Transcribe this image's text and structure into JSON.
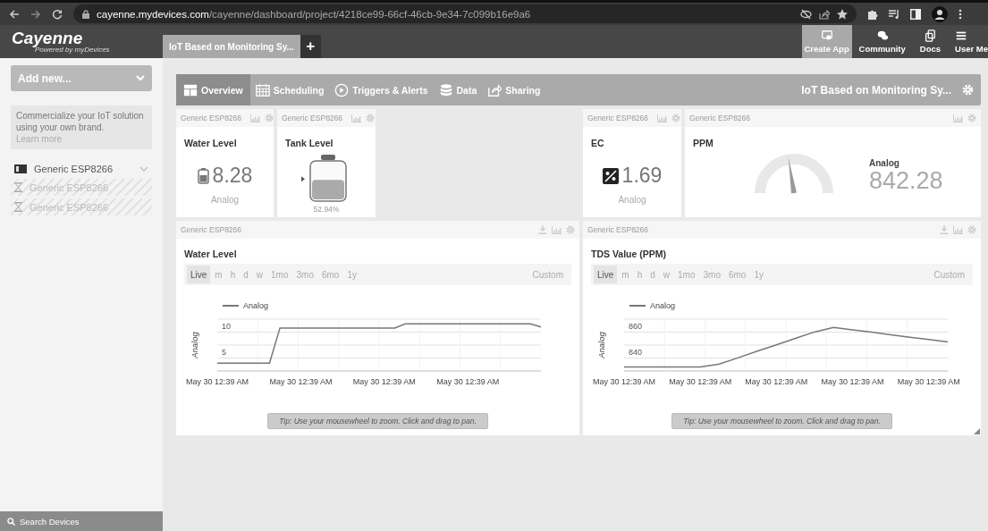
{
  "browser": {
    "url_host": "cayenne.mydevices.com",
    "url_path": "/cayenne/dashboard/project/4218ce99-66cf-46cb-9e34-7c099b16e9a6"
  },
  "app": {
    "logo": "Cayenne",
    "tagline": "Powered by myDevices"
  },
  "project_tabs": [
    {
      "label": "IoT Based on Monitoring Sy...",
      "selected": true
    }
  ],
  "add_tab": "+",
  "header_buttons": [
    {
      "label": "Create App",
      "selected": true
    },
    {
      "label": "Community",
      "selected": false
    },
    {
      "label": "Docs",
      "selected": false
    },
    {
      "label": "User Me",
      "selected": false
    }
  ],
  "sidebar": {
    "add_new": "Add new...",
    "promo": {
      "text": "Commercialize your IoT solution using your own brand.",
      "link": "Learn more"
    },
    "devices": [
      {
        "name": "Generic ESP8266",
        "kind": "device"
      },
      {
        "name": "Generic ESP8266",
        "kind": "pending"
      },
      {
        "name": "Generic ESP8266",
        "kind": "pending"
      }
    ],
    "search": "Search Devices"
  },
  "toolbar": {
    "tabs": [
      {
        "label": "Overview",
        "selected": true
      },
      {
        "label": "Scheduling",
        "selected": false
      },
      {
        "label": "Triggers & Alerts",
        "selected": false
      },
      {
        "label": "Data",
        "selected": false
      },
      {
        "label": "Sharing",
        "selected": false
      }
    ],
    "project_title": "IoT Based on Monitoring Sy..."
  },
  "widgets": [
    {
      "kind": "value",
      "device": "Generic ESP8266",
      "title": "Water Level",
      "value": "8.28",
      "caption": "Analog"
    },
    {
      "kind": "tank",
      "device": "Generic ESP8266",
      "title": "Tank Level",
      "level": 0.53,
      "reading": "52.94%"
    },
    {
      "kind": "value",
      "device": "Generic ESP8266",
      "title": "EC",
      "value": "1.69",
      "caption": "Analog"
    },
    {
      "kind": "gauge",
      "device": "Generic ESP8266",
      "title": "PPM",
      "level": 0.45,
      "caption": "Analog",
      "value": "842.28"
    }
  ],
  "charts": [
    {
      "device": "Generic ESP8266",
      "title": "Water Level",
      "ranges": [
        {
          "label": "Live",
          "selected": true
        },
        {
          "label": "m",
          "selected": false
        },
        {
          "label": "h",
          "selected": false
        },
        {
          "label": "d",
          "selected": false
        },
        {
          "label": "w",
          "selected": false
        },
        {
          "label": "1mo",
          "selected": false
        },
        {
          "label": "3mo",
          "selected": false
        },
        {
          "label": "6mo",
          "selected": false
        },
        {
          "label": "1y",
          "selected": false
        }
      ],
      "custom": "Custom",
      "tip": "Tip: Use your mousewheel to zoom. Click and drag to pan.",
      "chart_data": {
        "type": "line",
        "ylabel": "Analog",
        "grid": true,
        "categories": [
          "May 30 12:39 AM",
          null,
          null,
          null,
          null,
          null,
          null,
          null,
          "May 30 12:39 AM",
          null,
          null,
          null,
          null,
          null,
          null,
          null,
          "May 30 12:39 AM",
          null,
          null,
          null,
          null,
          null,
          null,
          null,
          "May 30 12:39 AM",
          null,
          null,
          null,
          null,
          null,
          null,
          null
        ],
        "series": [
          {
            "name": "Analog",
            "color": "#777777",
            "values": [
              4,
              4,
              4,
              4,
              4,
              4,
              10.8,
              10.8,
              10.8,
              10.8,
              10.8,
              10.8,
              10.8,
              10.8,
              10.8,
              10.8,
              10.8,
              10.8,
              11.6,
              11.6,
              11.6,
              11.6,
              11.6,
              11.6,
              11.6,
              11.6,
              11.6,
              11.6,
              11.6,
              11.6,
              11.6,
              11
            ]
          }
        ],
        "ylim": [
          2.5,
          12.5
        ],
        "yticks": [
          5,
          10
        ]
      }
    },
    {
      "device": "Generic ESP8266",
      "title": "TDS Value (PPM)",
      "ranges": [
        {
          "label": "Live",
          "selected": true
        },
        {
          "label": "m",
          "selected": false
        },
        {
          "label": "h",
          "selected": false
        },
        {
          "label": "d",
          "selected": false
        },
        {
          "label": "w",
          "selected": false
        },
        {
          "label": "1mo",
          "selected": false
        },
        {
          "label": "3mo",
          "selected": false
        },
        {
          "label": "6mo",
          "selected": false
        },
        {
          "label": "1y",
          "selected": false
        }
      ],
      "custom": "Custom",
      "tip": "Tip: Use your mousewheel to zoom. Click and drag to pan.",
      "chart_data": {
        "type": "line",
        "ylabel": "Analog",
        "grid": true,
        "categories": [
          "May 30 12:39 AM",
          null,
          null,
          null,
          "May 30 12:39 AM",
          null,
          null,
          null,
          "May 30 12:39 AM",
          null,
          null,
          null,
          "May 30 12:39 AM",
          null,
          null,
          null,
          "May 30 12:39 AM",
          null
        ],
        "series": [
          {
            "name": "Analog",
            "color": "#777777",
            "values": [
              833,
              833,
              833,
              833,
              833,
              835.4,
              840.3,
              845.3,
              850.2,
              855.2,
              860.1,
              863.6,
              861.7,
              859.9,
              858,
              856.1,
              854.3,
              852.4
            ]
          }
        ],
        "ylim": [
          830,
          870
        ],
        "yticks": [
          840,
          860
        ]
      }
    }
  ]
}
